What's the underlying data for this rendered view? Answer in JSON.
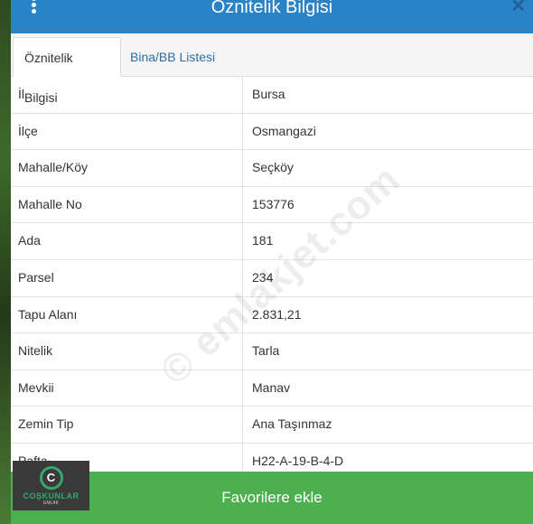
{
  "header": {
    "title": "Öznitelik Bilgisi",
    "close_glyph": "✕",
    "menu_icon": "vertical-dots-icon"
  },
  "tabs": [
    {
      "label": "Öznitelik Bilgisi",
      "active": true
    },
    {
      "label": "Bina/BB Listesi",
      "active": false
    }
  ],
  "rows": [
    {
      "key": "İl",
      "value": "Bursa"
    },
    {
      "key": "İlçe",
      "value": "Osmangazi"
    },
    {
      "key": "Mahalle/Köy",
      "value": "Seçköy"
    },
    {
      "key": "Mahalle No",
      "value": "153776"
    },
    {
      "key": "Ada",
      "value": "181"
    },
    {
      "key": "Parsel",
      "value": "234"
    },
    {
      "key": "Tapu Alanı",
      "value": "2.831,21"
    },
    {
      "key": "Nitelik",
      "value": "Tarla"
    },
    {
      "key": "Mevkii",
      "value": "Manav"
    },
    {
      "key": "Zemin Tip",
      "value": "Ana Taşınmaz"
    },
    {
      "key": "Pafta",
      "value": "H22-A-19-B-4-D"
    }
  ],
  "watermark": "© emlakjet.com",
  "footer": {
    "button_label": "Favorilere ekle"
  },
  "logo": {
    "letter": "C",
    "name": "COŞKUNLAR",
    "sub": "EMLAK"
  },
  "colors": {
    "header": "#2a83c6",
    "footer": "#4caf50",
    "tab_link": "#2a6fa8"
  }
}
